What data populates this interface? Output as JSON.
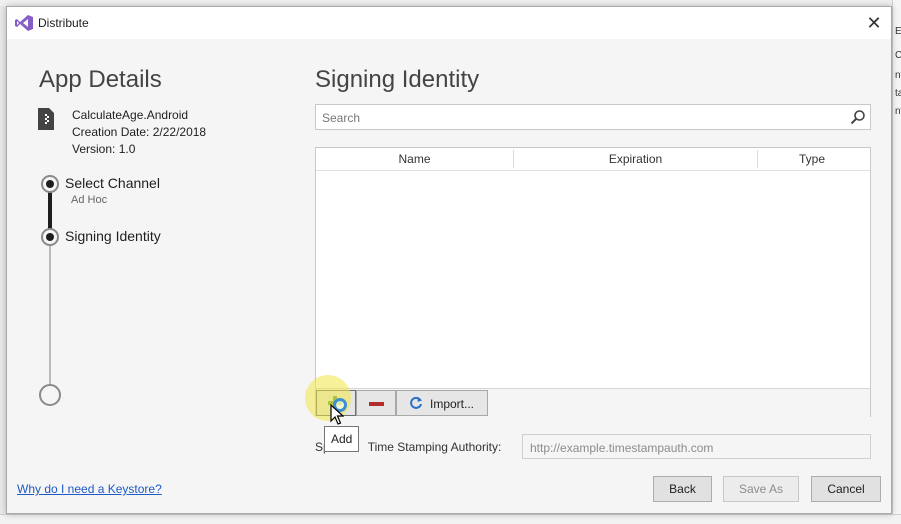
{
  "window": {
    "title": "Distribute",
    "close_glyph": "✕"
  },
  "app_details": {
    "heading": "App Details",
    "name": "CalculateAge.Android",
    "creation_date": "Creation Date: 2/22/2018",
    "version": "Version: 1.0"
  },
  "steps": [
    {
      "label": "Select Channel",
      "sublabel": "Ad Hoc",
      "state": "completed"
    },
    {
      "label": "Signing Identity",
      "sublabel": "",
      "state": "current"
    },
    {
      "label": "",
      "sublabel": "",
      "state": "pending"
    }
  ],
  "signing": {
    "heading": "Signing Identity",
    "search_placeholder": "Search",
    "columns": [
      "Name",
      "Expiration",
      "Type"
    ],
    "rows": [],
    "toolbar": {
      "add_tooltip": "Add",
      "import_label": "Import..."
    },
    "tsa_label": "Sp",
    "tsa_label_rest": "Time Stamping Authority:",
    "tsa_placeholder": "http://example.timestampauth.com"
  },
  "footer": {
    "help_link": "Why do I need a Keystore?",
    "back_label": "Back",
    "save_as_label": "Save As",
    "cancel_label": "Cancel"
  },
  "background_fragments": [
    "E",
    "Ca",
    "nt",
    "ta",
    "nt"
  ],
  "colors": {
    "accent_vs": "#865fc5",
    "add_green": "#58a028",
    "remove_red": "#b32d2d",
    "import_blue": "#2a6fc9",
    "link_blue": "#1e5bc6"
  }
}
